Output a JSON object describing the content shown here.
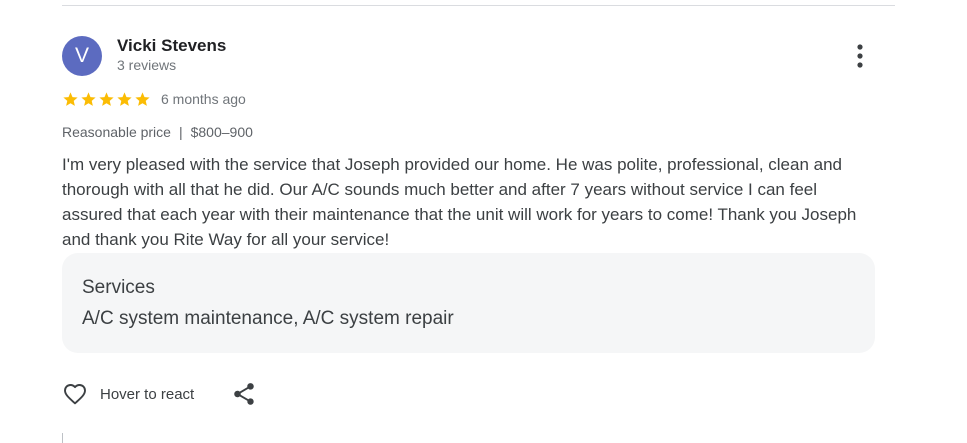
{
  "review": {
    "author": {
      "initial": "V",
      "name": "Vicki Stevens",
      "review_count": "3 reviews",
      "avatar_color": "#5c6bc0"
    },
    "rating": 5,
    "time": "6 months ago",
    "price": {
      "label": "Reasonable price",
      "separator": "|",
      "value": "$800–900"
    },
    "text": "I'm very pleased with the service that Joseph provided our home. He was polite, professional, clean and thorough with all that he did. Our A/C sounds much better and after 7 years without service I can feel assured that each year with their maintenance that the unit will work for years to come! Thank you Joseph and thank you Rite Way for all your service!",
    "services": {
      "heading": "Services",
      "list": "A/C system maintenance, A/C system repair"
    },
    "actions": {
      "react_label": "Hover to react",
      "react_icon": "heart-outline-icon",
      "share_icon": "share-icon",
      "more_icon": "more-vertical-icon"
    }
  },
  "colors": {
    "star": "#fbbc04",
    "text_primary": "#202124",
    "text_secondary": "#70757a",
    "services_bg": "#f5f6f7"
  }
}
